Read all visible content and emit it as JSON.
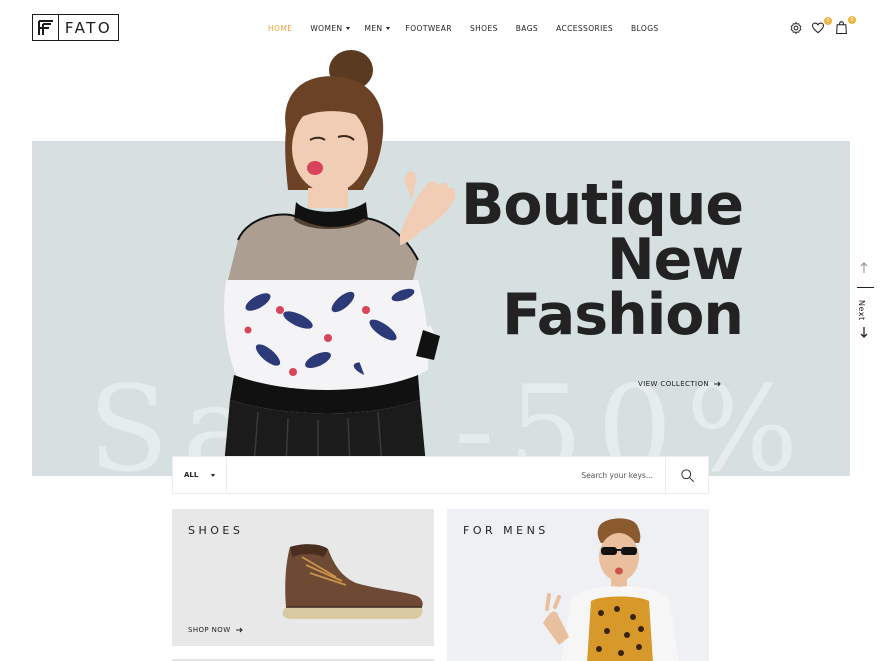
{
  "brand": {
    "name": "FATO",
    "logo_icon": "f-monogram-icon"
  },
  "nav": {
    "items": [
      {
        "label": "HOME",
        "active": true,
        "dropdown": false
      },
      {
        "label": "WOMEN",
        "active": false,
        "dropdown": true
      },
      {
        "label": "MEN",
        "active": false,
        "dropdown": true
      },
      {
        "label": "FOOTWEAR",
        "active": false,
        "dropdown": false
      },
      {
        "label": "SHOES",
        "active": false,
        "dropdown": false
      },
      {
        "label": "BAGS",
        "active": false,
        "dropdown": false
      },
      {
        "label": "ACCESSORIES",
        "active": false,
        "dropdown": false
      },
      {
        "label": "BLOGS",
        "active": false,
        "dropdown": false
      }
    ]
  },
  "header_icons": {
    "settings": "gear-icon",
    "wishlist": {
      "icon": "heart-icon",
      "count": "0"
    },
    "cart": {
      "icon": "shopping-bag-icon",
      "count": "0"
    }
  },
  "hero": {
    "title_line1": "Boutique",
    "title_line2": "New",
    "title_line3": "Fashion",
    "watermark": "Sale -50%",
    "cta": "VIEW COLLECTION",
    "next_label": "Next"
  },
  "search": {
    "category": "ALL",
    "placeholder": "Search your keys..."
  },
  "banners": {
    "shoes": {
      "title": "SHOES",
      "cta": "SHOP NOW"
    },
    "mens": {
      "title": "FOR MENS"
    }
  },
  "colors": {
    "accent": "#e8a43c",
    "hero_bg": "#d6e0e0",
    "badge": "#f0b33a",
    "text": "#222222"
  }
}
